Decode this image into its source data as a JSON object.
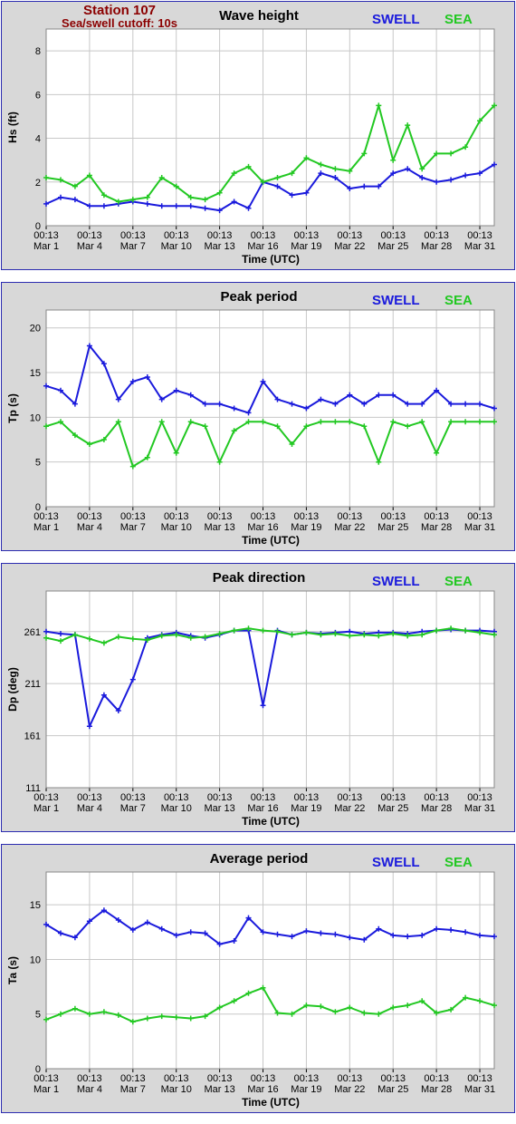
{
  "station": {
    "name": "Station 107",
    "cutoff": "Sea/swell cutoff: 10s"
  },
  "legend": {
    "swell": "SWELL",
    "sea": "SEA"
  },
  "colors": {
    "swell": "#1a1adc",
    "sea": "#22c822",
    "frame": "#2b2bb0",
    "background": "#d8d8d8",
    "plot": "#ffffff",
    "grid": "#c8c8c8"
  },
  "x_axis": {
    "label": "Time (UTC)",
    "ticks": [
      {
        "time": "00:13",
        "date": "Mar 1"
      },
      {
        "time": "00:13",
        "date": "Mar 4"
      },
      {
        "time": "00:13",
        "date": "Mar 7"
      },
      {
        "time": "00:13",
        "date": "Mar 10"
      },
      {
        "time": "00:13",
        "date": "Mar 13"
      },
      {
        "time": "00:13",
        "date": "Mar 16"
      },
      {
        "time": "00:13",
        "date": "Mar 19"
      },
      {
        "time": "00:13",
        "date": "Mar 22"
      },
      {
        "time": "00:13",
        "date": "Mar 25"
      },
      {
        "time": "00:13",
        "date": "Mar 28"
      },
      {
        "time": "00:13",
        "date": "Mar 31"
      }
    ]
  },
  "chart_data": [
    {
      "type": "line",
      "title": "Wave height",
      "ylabel": "Hs (ft)",
      "ylim": [
        0,
        9
      ],
      "yticks": [
        0,
        2,
        4,
        6,
        8
      ],
      "xlim": [
        "Mar 1",
        "Apr 1"
      ],
      "grid": true,
      "x": [
        "Mar 1",
        "Mar 2",
        "Mar 3",
        "Mar 4",
        "Mar 5",
        "Mar 6",
        "Mar 7",
        "Mar 8",
        "Mar 9",
        "Mar 10",
        "Mar 11",
        "Mar 12",
        "Mar 13",
        "Mar 14",
        "Mar 15",
        "Mar 16",
        "Mar 17",
        "Mar 18",
        "Mar 19",
        "Mar 20",
        "Mar 21",
        "Mar 22",
        "Mar 23",
        "Mar 24",
        "Mar 25",
        "Mar 26",
        "Mar 27",
        "Mar 28",
        "Mar 29",
        "Mar 30",
        "Mar 31",
        "Apr 1"
      ],
      "series": [
        {
          "name": "SWELL",
          "values": [
            1.0,
            1.3,
            1.2,
            0.9,
            0.9,
            1.0,
            1.1,
            1.0,
            0.9,
            0.9,
            0.9,
            0.8,
            0.7,
            1.1,
            0.8,
            2.0,
            1.8,
            1.4,
            1.5,
            2.4,
            2.2,
            1.7,
            1.8,
            1.8,
            2.4,
            2.6,
            2.2,
            2.0,
            2.1,
            2.3,
            2.4,
            2.8
          ]
        },
        {
          "name": "SEA",
          "values": [
            2.2,
            2.1,
            1.8,
            2.3,
            1.4,
            1.1,
            1.2,
            1.3,
            2.2,
            1.8,
            1.3,
            1.2,
            1.5,
            2.4,
            2.7,
            2.0,
            2.2,
            2.4,
            3.1,
            2.8,
            2.6,
            2.5,
            3.3,
            5.5,
            3.0,
            4.6,
            2.6,
            3.3,
            3.3,
            3.6,
            4.8,
            5.5
          ]
        }
      ]
    },
    {
      "type": "line",
      "title": "Peak period",
      "ylabel": "Tp (s)",
      "ylim": [
        0,
        22
      ],
      "yticks": [
        0,
        5,
        10,
        15,
        20
      ],
      "xlim": [
        "Mar 1",
        "Apr 1"
      ],
      "grid": true,
      "x": [
        "Mar 1",
        "Mar 2",
        "Mar 3",
        "Mar 4",
        "Mar 5",
        "Mar 6",
        "Mar 7",
        "Mar 8",
        "Mar 9",
        "Mar 10",
        "Mar 11",
        "Mar 12",
        "Mar 13",
        "Mar 14",
        "Mar 15",
        "Mar 16",
        "Mar 17",
        "Mar 18",
        "Mar 19",
        "Mar 20",
        "Mar 21",
        "Mar 22",
        "Mar 23",
        "Mar 24",
        "Mar 25",
        "Mar 26",
        "Mar 27",
        "Mar 28",
        "Mar 29",
        "Mar 30",
        "Mar 31",
        "Apr 1"
      ],
      "series": [
        {
          "name": "SWELL",
          "values": [
            13.5,
            13.0,
            11.5,
            18.0,
            16.0,
            12.0,
            14.0,
            14.5,
            12.0,
            13.0,
            12.5,
            11.5,
            11.5,
            11.0,
            10.5,
            14.0,
            12.0,
            11.5,
            11.0,
            12.0,
            11.5,
            12.5,
            11.5,
            12.5,
            12.5,
            11.5,
            11.5,
            13.0,
            11.5,
            11.5,
            11.5,
            11.0
          ]
        },
        {
          "name": "SEA",
          "values": [
            9.0,
            9.5,
            8.0,
            7.0,
            7.5,
            9.5,
            4.5,
            5.5,
            9.5,
            6.0,
            9.5,
            9.0,
            5.0,
            8.5,
            9.5,
            9.5,
            9.0,
            7.0,
            9.0,
            9.5,
            9.5,
            9.5,
            9.0,
            5.0,
            9.5,
            9.0,
            9.5,
            6.0,
            9.5,
            9.5,
            9.5,
            9.5
          ]
        }
      ]
    },
    {
      "type": "line",
      "title": "Peak direction",
      "ylabel": "Dp (deg)",
      "ylim": [
        111,
        300
      ],
      "yticks": [
        111,
        161,
        211,
        261
      ],
      "xlim": [
        "Mar 1",
        "Apr 1"
      ],
      "grid": true,
      "x": [
        "Mar 1",
        "Mar 2",
        "Mar 3",
        "Mar 4",
        "Mar 5",
        "Mar 6",
        "Mar 7",
        "Mar 8",
        "Mar 9",
        "Mar 10",
        "Mar 11",
        "Mar 12",
        "Mar 13",
        "Mar 14",
        "Mar 15",
        "Mar 16",
        "Mar 17",
        "Mar 18",
        "Mar 19",
        "Mar 20",
        "Mar 21",
        "Mar 22",
        "Mar 23",
        "Mar 24",
        "Mar 25",
        "Mar 26",
        "Mar 27",
        "Mar 28",
        "Mar 29",
        "Mar 30",
        "Mar 31",
        "Apr 1"
      ],
      "series": [
        {
          "name": "SWELL",
          "values": [
            261,
            259,
            258,
            170,
            200,
            185,
            215,
            255,
            258,
            260,
            257,
            255,
            258,
            262,
            262,
            190,
            262,
            258,
            260,
            259,
            260,
            261,
            259,
            260,
            260,
            259,
            261,
            262,
            263,
            262,
            262,
            261
          ]
        },
        {
          "name": "SEA",
          "values": [
            255,
            252,
            258,
            254,
            250,
            256,
            254,
            253,
            257,
            258,
            255,
            256,
            259,
            262,
            264,
            262,
            261,
            258,
            260,
            258,
            259,
            257,
            258,
            257,
            259,
            257,
            258,
            262,
            264,
            262,
            260,
            258
          ]
        }
      ]
    },
    {
      "type": "line",
      "title": "Average period",
      "ylabel": "Ta (s)",
      "ylim": [
        0,
        18
      ],
      "yticks": [
        0,
        5,
        10,
        15
      ],
      "xlim": [
        "Mar 1",
        "Apr 1"
      ],
      "grid": true,
      "x": [
        "Mar 1",
        "Mar 2",
        "Mar 3",
        "Mar 4",
        "Mar 5",
        "Mar 6",
        "Mar 7",
        "Mar 8",
        "Mar 9",
        "Mar 10",
        "Mar 11",
        "Mar 12",
        "Mar 13",
        "Mar 14",
        "Mar 15",
        "Mar 16",
        "Mar 17",
        "Mar 18",
        "Mar 19",
        "Mar 20",
        "Mar 21",
        "Mar 22",
        "Mar 23",
        "Mar 24",
        "Mar 25",
        "Mar 26",
        "Mar 27",
        "Mar 28",
        "Mar 29",
        "Mar 30",
        "Mar 31",
        "Apr 1"
      ],
      "series": [
        {
          "name": "SWELL",
          "values": [
            13.2,
            12.4,
            12.0,
            13.5,
            14.5,
            13.6,
            12.7,
            13.4,
            12.8,
            12.2,
            12.5,
            12.4,
            11.4,
            11.7,
            13.8,
            12.5,
            12.3,
            12.1,
            12.6,
            12.4,
            12.3,
            12.0,
            11.8,
            12.8,
            12.2,
            12.1,
            12.2,
            12.8,
            12.7,
            12.5,
            12.2,
            12.1
          ]
        },
        {
          "name": "SEA",
          "values": [
            4.5,
            5.0,
            5.5,
            5.0,
            5.2,
            4.9,
            4.3,
            4.6,
            4.8,
            4.7,
            4.6,
            4.8,
            5.6,
            6.2,
            6.9,
            7.4,
            5.1,
            5.0,
            5.8,
            5.7,
            5.2,
            5.6,
            5.1,
            5.0,
            5.6,
            5.8,
            6.2,
            5.1,
            5.4,
            6.5,
            6.2,
            5.8
          ]
        }
      ]
    }
  ]
}
